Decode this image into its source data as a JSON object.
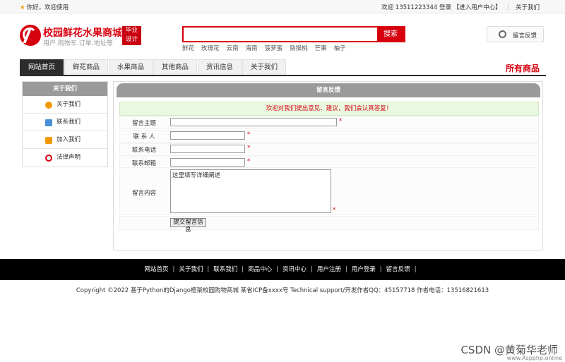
{
  "topbar": {
    "welcome": "你好，欢迎使用",
    "user_login": "欢迎 13511223344 登录",
    "user_center": "【进入用户中心】",
    "about": "关于我们"
  },
  "logo": {
    "title": "校园鲜花水果商城",
    "subtitle": "用户.购物车.订单.地址等",
    "badge_line1": "毕业",
    "badge_line2": "设计"
  },
  "search": {
    "placeholder": "",
    "button": "搜索",
    "keywords": [
      "鲜花",
      "玫瑰花",
      "云南",
      "海南",
      "菠萝蜜",
      "猕猴桃",
      "芒果",
      "柚子"
    ]
  },
  "feedback_button": "留言反馈",
  "nav": {
    "items": [
      "网站首页",
      "鲜花商品",
      "水果商品",
      "其他商品",
      "资讯信息",
      "关于我们"
    ],
    "all_goods": "所有商品"
  },
  "sidebar": {
    "title": "关于我们",
    "items": [
      "关于我们",
      "联系我们",
      "加入我们",
      "法律声明"
    ]
  },
  "form": {
    "title": "留言反馈",
    "notice": "欢迎对我们提出意见、建议，我们会认真答复！",
    "subject_label": "留言主题",
    "contact_label": "联 系 人",
    "phone_label": "联系电话",
    "email_label": "联系邮箱",
    "content_label": "留言内容",
    "content_value": "这里填写详细阐述",
    "required_mark": "*",
    "submit": "提交留言信息"
  },
  "footer": {
    "links": [
      "网站首页",
      "关于我们",
      "联系我们",
      "商品中心",
      "资讯中心",
      "用户注册",
      "用户登录",
      "留言反馈"
    ],
    "copyright": "Copyright ©2022 基于Python的Django框架校园购物商城 某省ICP备xxxx号    Technical support/开发作者QQ：45157718     作者电话：13516821613"
  },
  "watermark": {
    "csdn": "CSDN @黄菊华老师",
    "site": "www.Aspphp.online"
  },
  "colors": {
    "brand_red": "#d7000f",
    "nav_dark": "#2c2c2c",
    "panel_gray": "#9a9a9a",
    "notice_green": "#e9f8e0"
  }
}
